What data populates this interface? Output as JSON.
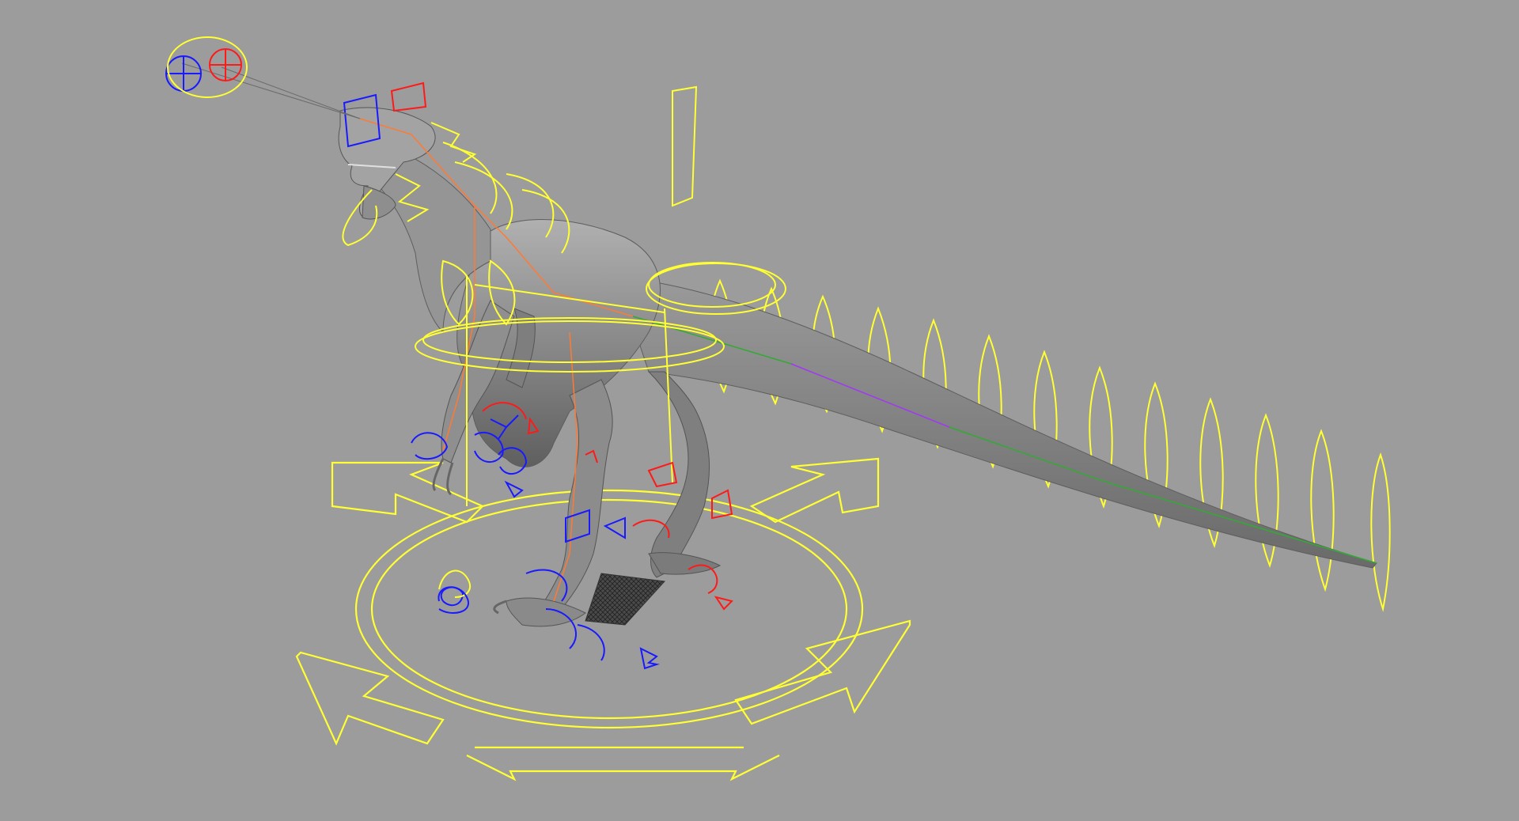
{
  "viewport": {
    "background": "#9c9c9c",
    "colors": {
      "mesh_fill": "#8a8a8a",
      "mesh_shade": "#6f6f6f",
      "mesh_light": "#b5b5b5",
      "control_primary": "#ffff33",
      "control_left": "#1a1aff",
      "control_right": "#ff1a1a",
      "aim_line": "#6a6a6a",
      "foot_pad": "#3a3a3a"
    },
    "rig_controls": [
      {
        "name": "master-move",
        "shape": "four-arrow-circle"
      },
      {
        "name": "eye-aim-left",
        "shape": "circle-cross"
      },
      {
        "name": "eye-aim-right",
        "shape": "circle-cross"
      },
      {
        "name": "spine",
        "shape": "rings"
      },
      {
        "name": "tail",
        "shape": "leaf-loops"
      },
      {
        "name": "hand-left",
        "shape": "curl-arrows"
      },
      {
        "name": "hand-right",
        "shape": "curl-arrows"
      },
      {
        "name": "foot-left",
        "shape": "curl-arrows"
      },
      {
        "name": "foot-right",
        "shape": "curl-arrows"
      }
    ]
  }
}
